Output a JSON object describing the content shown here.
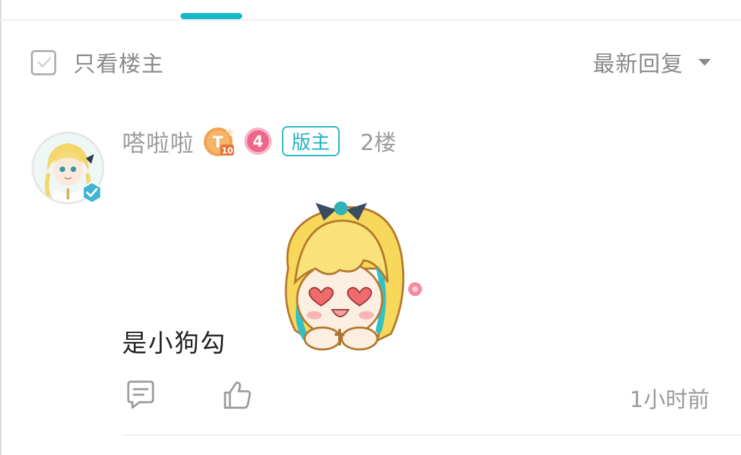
{
  "filter": {
    "only_op_label": "只看楼主",
    "only_op_checked": false,
    "sort_label": "最新回复"
  },
  "post": {
    "username": "嗒啦啦",
    "badge_title": "T10",
    "badge_title_main": "T",
    "badge_title_sub": "10",
    "level": "4",
    "role": "版主",
    "floor": "2楼",
    "content": "是小狗勾",
    "time": "1小时前"
  },
  "colors": {
    "accent": "#16b7c6",
    "role": "#23b2c1",
    "muted_text": "#9b9b9b",
    "level_badge": "#f0668a",
    "title_badge": "#f08a3c"
  },
  "icons": {
    "checkbox": "checkbox-icon",
    "dropdown": "chevron-down-icon",
    "verified": "verified-icon",
    "comment": "comment-icon",
    "like": "thumbs-up-icon"
  }
}
